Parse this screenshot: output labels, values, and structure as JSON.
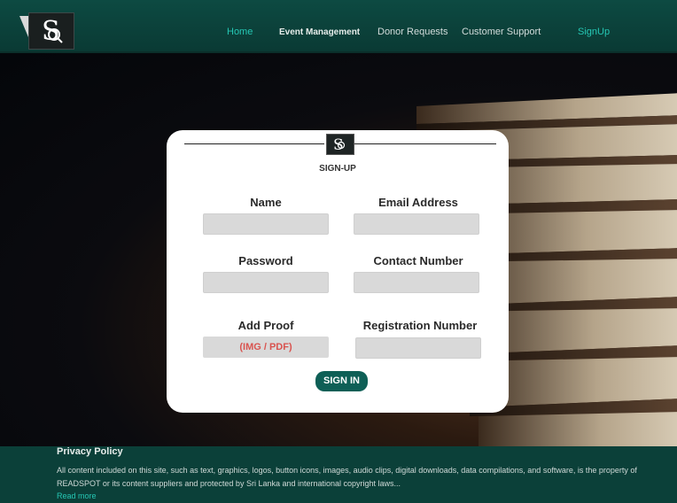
{
  "header": {
    "nav": [
      {
        "label": "Home"
      },
      {
        "label": "Event Management"
      },
      {
        "label": "Donor Requests"
      },
      {
        "label": "Customer Support"
      },
      {
        "label": "SignUp"
      }
    ]
  },
  "form": {
    "title": "SIGN-UP",
    "fields": {
      "name": {
        "label": "Name",
        "value": ""
      },
      "email": {
        "label": "Email Address",
        "value": ""
      },
      "password": {
        "label": "Password",
        "value": ""
      },
      "contact": {
        "label": "Contact Number",
        "value": ""
      },
      "proof": {
        "label": "Add Proof",
        "button": "(IMG / PDF)"
      },
      "registration": {
        "label": "Registration Number",
        "value": ""
      }
    },
    "submit_label": "SIGN IN"
  },
  "footer": {
    "title": "Privacy Policy",
    "text": "All content included on this site, such as text, graphics, logos, button icons, images, audio clips, digital downloads, data compilations, and software, is the property of READSPOT or its content suppliers and protected by Sri Lanka and international copyright laws...",
    "link": "Read more"
  },
  "colors": {
    "brand": "#0b4039",
    "accent": "#25c7b4",
    "button": "#0e5f56",
    "proof_text": "#d9534f"
  }
}
